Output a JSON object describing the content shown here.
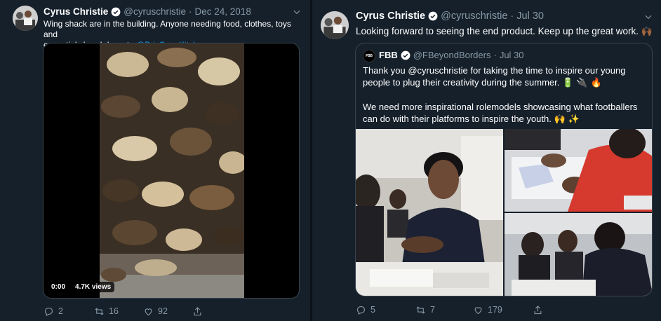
{
  "left_tweet": {
    "author_name": "Cyrus Christie",
    "handle": "@cyruschristie",
    "date": "Dec 24, 2018",
    "text_lines": [
      "Wing shack are in the building. Anyone needing food, clothes, toys and",
      "essentials head down to "
    ],
    "mention_link": "@BrixSoupKitchen",
    "video": {
      "time": "0:00",
      "views": "4.7K views"
    },
    "actions": {
      "replies": "2",
      "retweets": "16",
      "likes": "92"
    }
  },
  "right_tweet": {
    "author_name": "Cyrus Christie",
    "handle": "@cyruschristie",
    "date": "Jul 30",
    "text": "Looking forward to seeing the end product. Keep up the great work.",
    "text_emoji": "🙌🏾",
    "quoted": {
      "avatar_text": "FBB",
      "author_name": "FBB",
      "handle": "@FBeyondBorders",
      "date": "Jul 30",
      "para1_line1": "Thank you @cyruschristie for taking the time to inspire our young",
      "para1_line2": "people to plug their creativity during the summer.",
      "para1_emojis": "🔋 🔌 🔥",
      "para2_line1": "We need more inspirational rolemodels showcasing what footballers",
      "para2_line2": "can do with their platforms to inspire the youth.",
      "para2_emojis": "🙌 ✨"
    },
    "actions": {
      "replies": "5",
      "retweets": "7",
      "likes": "179"
    }
  },
  "colors": {
    "background": "#15202b",
    "text": "#ffffff",
    "muted": "#8899a6",
    "link": "#1da1f2",
    "border": "#38444d"
  },
  "icons": [
    "verified-badge-icon",
    "chevron-down-icon",
    "reply-icon",
    "retweet-icon",
    "like-icon",
    "share-icon"
  ]
}
